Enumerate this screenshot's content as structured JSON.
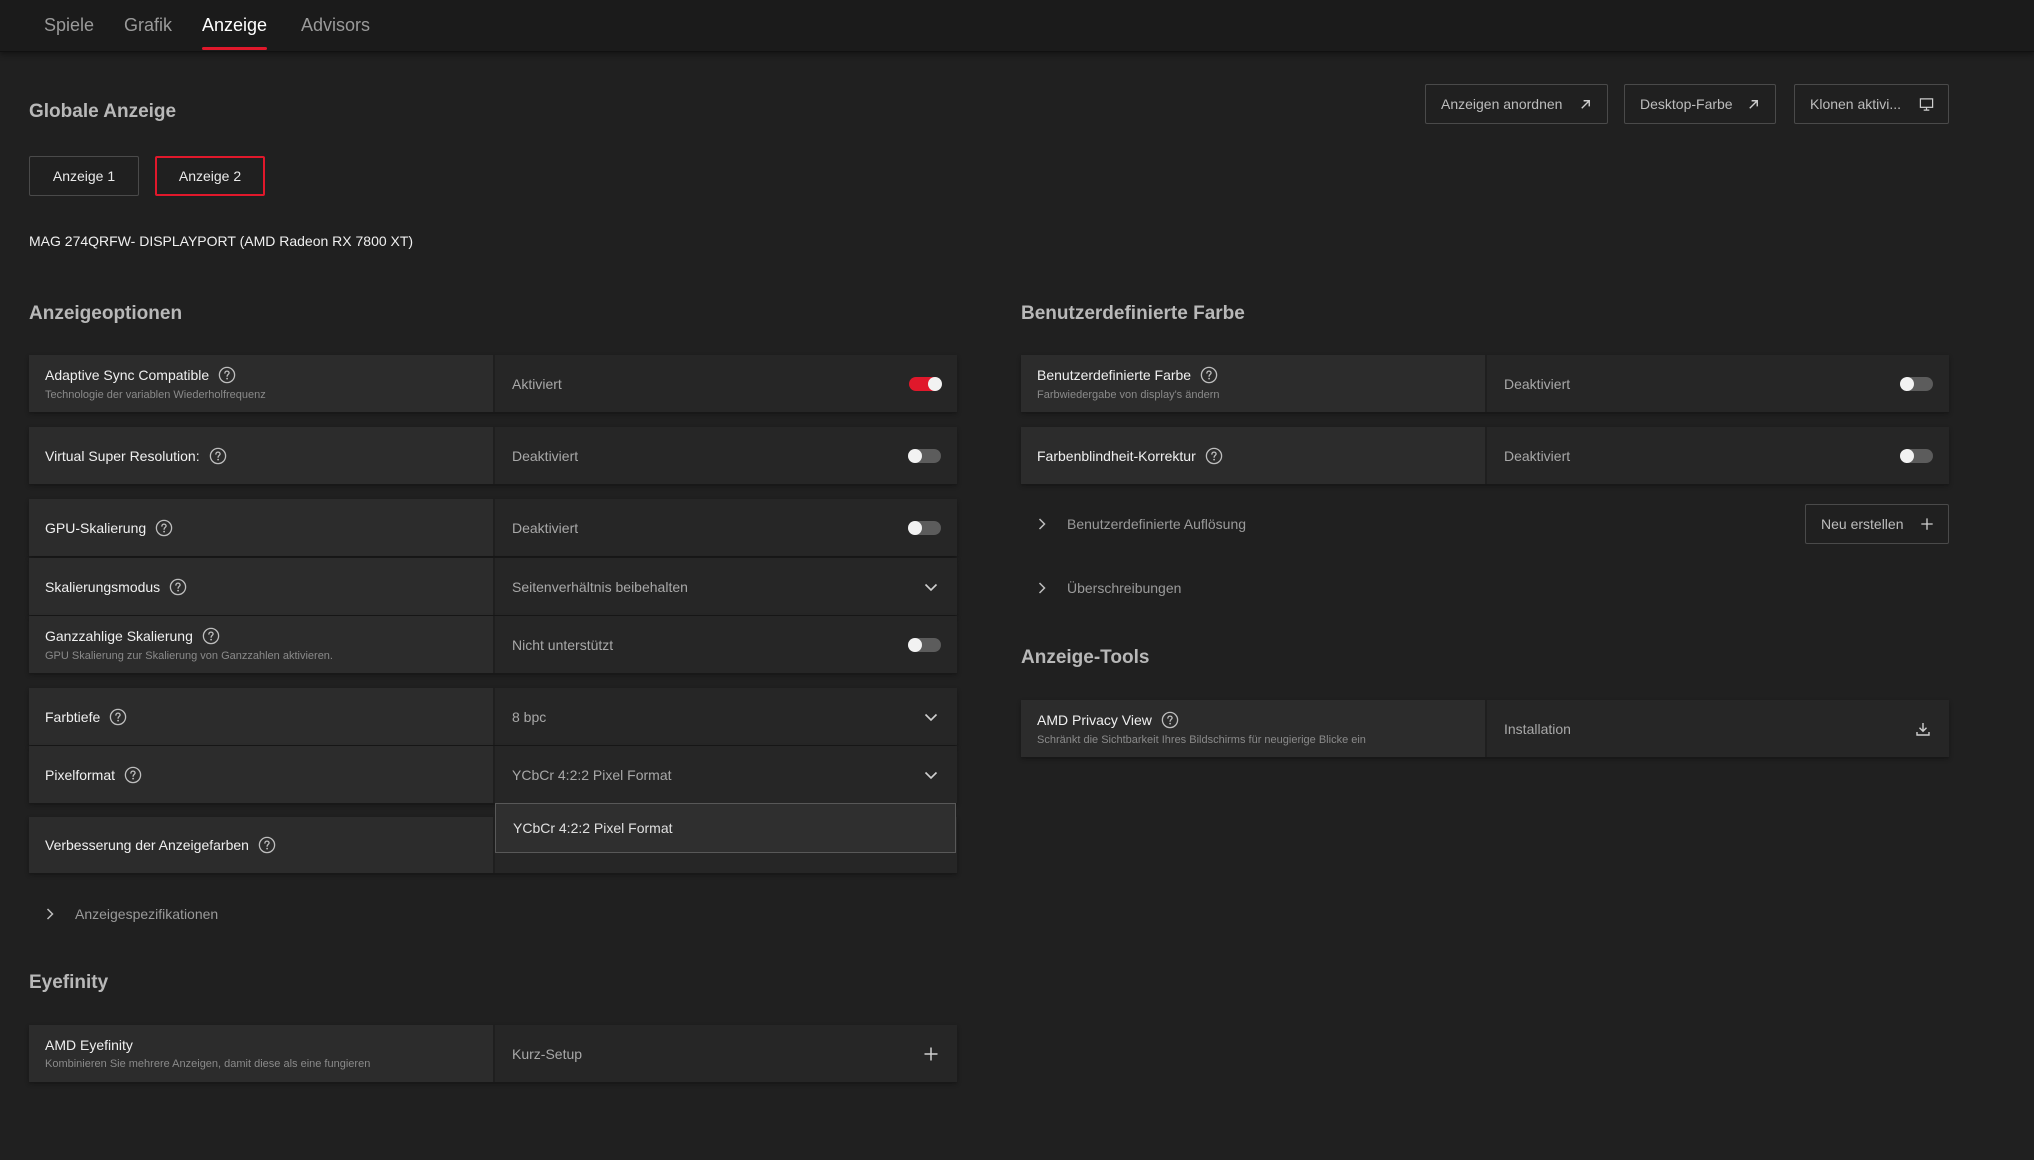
{
  "nav": {
    "tabs": [
      {
        "label": "Spiele"
      },
      {
        "label": "Grafik"
      },
      {
        "label": "Anzeige"
      },
      {
        "label": "Advisors"
      }
    ],
    "active": "Anzeige"
  },
  "global": {
    "heading": "Globale Anzeige",
    "buttons": {
      "arrange": "Anzeigen anordnen",
      "desktop_color": "Desktop-Farbe",
      "clone": "Klonen aktivi..."
    },
    "displays": [
      "Anzeige 1",
      "Anzeige 2"
    ],
    "selected_display": "Anzeige 2",
    "monitor_name": "MAG 274QRFW- DISPLAYPORT (AMD Radeon RX 7800 XT)"
  },
  "display_options": {
    "heading": "Anzeigeoptionen",
    "rows": {
      "adaptive_sync": {
        "title": "Adaptive Sync Compatible",
        "sub": "Technologie der variablen Wiederholfrequenz",
        "value": "Aktiviert",
        "on": true
      },
      "vsr": {
        "title": "Virtual Super Resolution:",
        "value": "Deaktiviert",
        "on": false
      },
      "gpu_scaling": {
        "title": "GPU-Skalierung",
        "value": "Deaktiviert",
        "on": false
      },
      "scaling_mode": {
        "title": "Skalierungsmodus",
        "value": "Seitenverhältnis beibehalten"
      },
      "integer_scaling": {
        "title": "Ganzzahlige Skalierung",
        "sub": "GPU Skalierung zur Skalierung von Ganzzahlen aktivieren.",
        "value": "Nicht unterstützt",
        "on": false
      },
      "color_depth": {
        "title": "Farbtiefe",
        "value": "8 bpc"
      },
      "pixel_format": {
        "title": "Pixelformat",
        "value": "YCbCr 4:2:2 Pixel Format"
      },
      "color_enhance": {
        "title": "Verbesserung der Anzeigefarben"
      }
    },
    "dropdown_option": "YCbCr 4:2:2 Pixel Format",
    "specs_expander": "Anzeigespezifikationen"
  },
  "custom_color": {
    "heading": "Benutzerdefinierte Farbe",
    "rows": {
      "custom_color": {
        "title": "Benutzerdefinierte Farbe",
        "sub": "Farbwiedergabe von display's ändern",
        "value": "Deaktiviert",
        "on": false
      },
      "colorblind": {
        "title": "Farbenblindheit-Korrektur",
        "value": "Deaktiviert",
        "on": false
      }
    },
    "custom_resolution": "Benutzerdefinierte Auflösung",
    "new_button": "Neu erstellen",
    "overrides": "Überschreibungen"
  },
  "tools": {
    "heading": "Anzeige-Tools",
    "privacy": {
      "title": "AMD Privacy View",
      "sub": "Schränkt die Sichtbarkeit Ihres Bildschirms für neugierige Blicke ein",
      "value": "Installation"
    }
  },
  "eyefinity": {
    "heading": "Eyefinity",
    "row": {
      "title": "AMD Eyefinity",
      "sub": "Kombinieren Sie mehrere Anzeigen, damit diese als eine fungieren",
      "value": "Kurz-Setup"
    }
  },
  "colors": {
    "accent": "#e0182b",
    "background": "#202020"
  }
}
